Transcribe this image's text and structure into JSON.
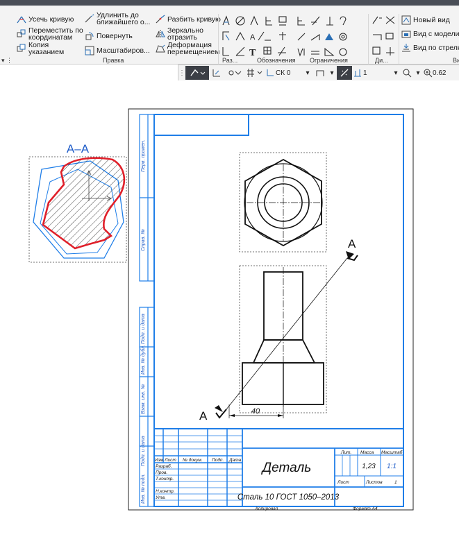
{
  "ribbon": {
    "edit_group": {
      "label": "Правка",
      "buttons": [
        {
          "id": "trim",
          "label": "Усечь кривую",
          "icon": "trim-curve-icon"
        },
        {
          "id": "extend",
          "label": "Удлинить до ближайшего о...",
          "icon": "extend-icon"
        },
        {
          "id": "split",
          "label": "Разбить кривую",
          "icon": "split-curve-icon"
        },
        {
          "id": "move",
          "label": "Переместить по координатам",
          "icon": "move-icon"
        },
        {
          "id": "rotate",
          "label": "Повернуть",
          "icon": "rotate-icon"
        },
        {
          "id": "mirror",
          "label": "Зеркально отразить",
          "icon": "mirror-icon"
        },
        {
          "id": "copy",
          "label": "Копия указанием",
          "icon": "copy-icon"
        },
        {
          "id": "scale",
          "label": "Масштабиров...",
          "icon": "scale-icon"
        },
        {
          "id": "deform",
          "label": "Деформация перемещением",
          "icon": "deform-icon"
        }
      ]
    },
    "sizes_group": {
      "label": "Раз..."
    },
    "annotations_group": {
      "label": "Обозначения"
    },
    "constraints_group": {
      "label": "Ограничения"
    },
    "dim_group": {
      "label": "Ди..."
    },
    "views_group": {
      "label": "Ви",
      "buttons": [
        {
          "id": "new_view",
          "label": "Новый вид",
          "icon": "new-view-icon"
        },
        {
          "id": "view_model",
          "label": "Вид с модели...",
          "icon": "view-model-icon"
        },
        {
          "id": "view_arrow",
          "label": "Вид по стрелке",
          "icon": "view-arrow-icon"
        }
      ]
    }
  },
  "statusbar": {
    "cs": "СК 0",
    "step": "1",
    "zoom": "0.62"
  },
  "drawing": {
    "section_label": "А–А",
    "cut_label_top": "А",
    "cut_label_bottom": "А",
    "dimension": "40",
    "stamp": {
      "title": "Деталь",
      "material": "Сталь 10  ГОСТ 1050–2013",
      "mass": "1,23",
      "scale": "1:1",
      "col_lit": "Лит.",
      "col_mass": "Масса",
      "col_scale": "Масштаб",
      "sheet": "Лист",
      "sheets": "Листов",
      "sheets_count": "1",
      "copied": "Копировал",
      "format": "Формат   А4",
      "row_headers": [
        "Изм.",
        "Лист",
        "№ докум.",
        "Подп.",
        "Дата"
      ],
      "roles": [
        "Разраб.",
        "Пров.",
        "Т.контр.",
        "",
        "Н.контр.",
        "Утв."
      ]
    },
    "side_labels": [
      "Перв. примен.",
      "Справ. №",
      "Подп. и дата",
      "Инв. № дубл.",
      "Взам. инв. №",
      "Подп. и дата",
      "Инв. № подл."
    ]
  }
}
